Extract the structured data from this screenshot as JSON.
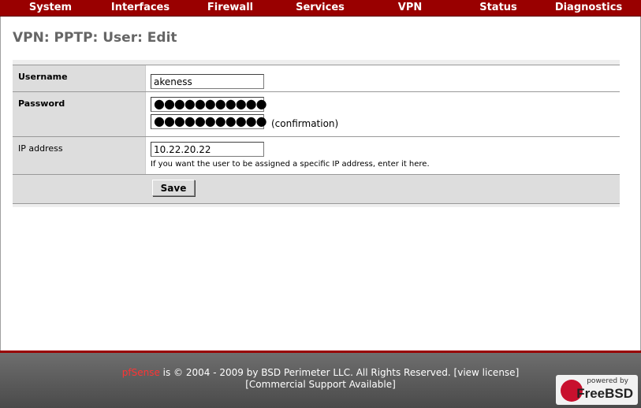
{
  "nav": {
    "items": [
      "System",
      "Interfaces",
      "Firewall",
      "Services",
      "VPN",
      "Status",
      "Diagnostics"
    ]
  },
  "page_title": "VPN: PPTP: User: Edit",
  "form": {
    "username_label": "Username",
    "username_value": "akeness",
    "password_label": "Password",
    "password_mask": "●●●●●●●●●●●",
    "password_confirm_mask": "●●●●●●●●●●●",
    "confirmation_label": "(confirmation)",
    "ip_label": "IP address",
    "ip_value": "10.22.20.22",
    "ip_hint": "If you want the user to be assigned a specific IP address, enter it here.",
    "save_label": "Save"
  },
  "footer": {
    "brand": "pfSense",
    "copyright": " is © 2004 - 2009 by BSD Perimeter LLC. All Rights Reserved. [",
    "view_license": "view license",
    "close_bracket": "]",
    "commercial_support": "[Commercial Support Available]",
    "powered_by": "powered by",
    "freebsd": "FreeBSD"
  },
  "colors": {
    "nav_bg": "#990000",
    "label_bg": "#dddddd",
    "title": "#666666",
    "footer_bg": "#5a5a5a"
  }
}
